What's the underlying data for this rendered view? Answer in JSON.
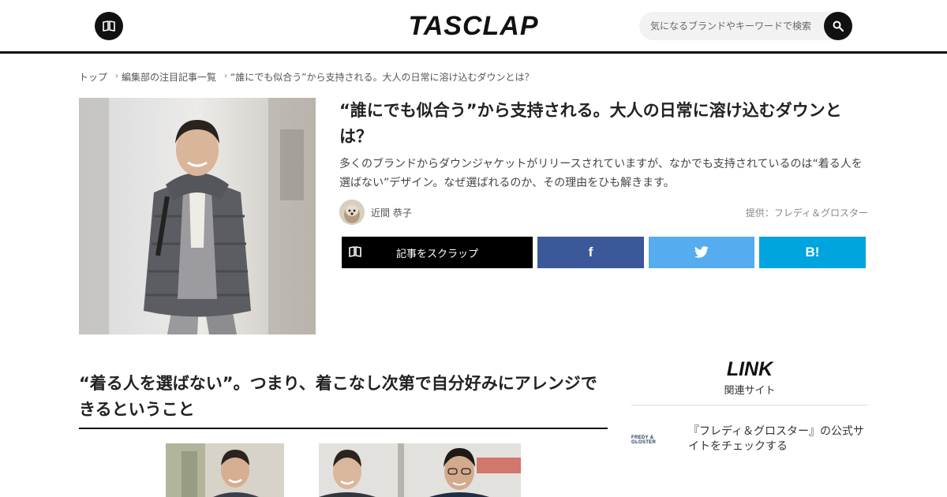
{
  "header": {
    "logo_text": "TASCLAP",
    "menu_icon": "book-icon",
    "search": {
      "placeholder": "気になるブランドやキーワードで検索",
      "icon": "search-icon"
    }
  },
  "breadcrumb": [
    "トップ",
    "編集部の注目記事一覧",
    "“誰にでも似合う”から支持される。大人の日常に溶け込むダウンとは？"
  ],
  "article": {
    "title": "“誰にでも似合う”から支持される。大人の日常に溶け込むダウンとは？",
    "lead": "多くのブランドからダウンジャケットがリリースされていますが、なかでも支持されているのは“着る人を選ばない”デザイン。なぜ選ばれるのか、その理由をひも解きます。",
    "author": "近間 恭子",
    "sponsor": "提供：フレディ＆グロスター"
  },
  "share": {
    "scrap_label": "記事をスクラップ",
    "facebook_label": "f",
    "hatena_label": "B!"
  },
  "section": {
    "title": "“着る人を選ばない”。つまり、着こなし次第で自分好みにアレンジできるということ"
  },
  "sidebar": {
    "heading": "LINK",
    "subheading": "関連サイト",
    "items": [
      {
        "logo": "FREDY & GLOSTER",
        "text": "『フレディ＆グロスター』の公式サイトをチェックする"
      }
    ]
  },
  "colors": {
    "facebook": "#3b5998",
    "twitter": "#55acee",
    "hatena": "#00a4de",
    "scrap": "#000000"
  }
}
